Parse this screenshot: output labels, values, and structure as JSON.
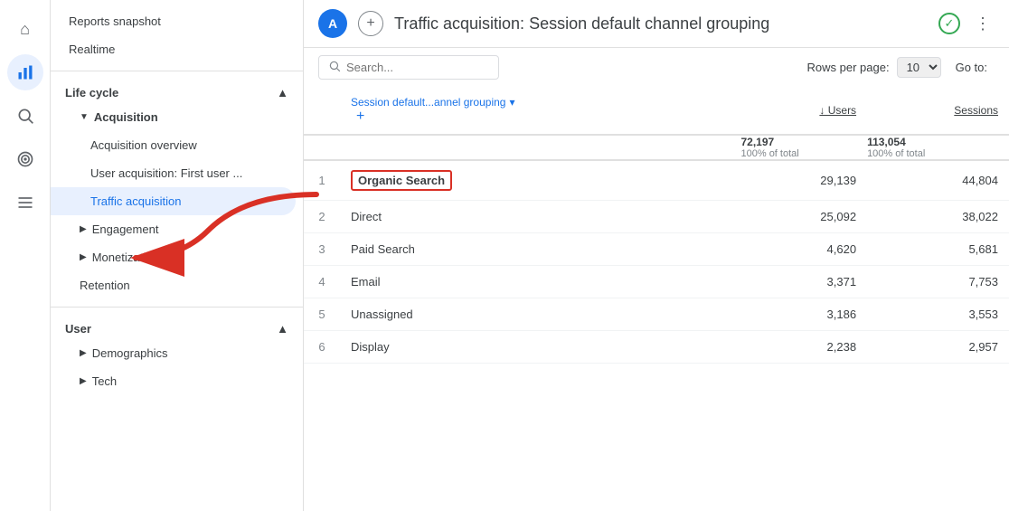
{
  "rail": {
    "icons": [
      {
        "name": "home-icon",
        "symbol": "⌂",
        "active": false
      },
      {
        "name": "chart-icon",
        "symbol": "📊",
        "active": true
      },
      {
        "name": "search-icon",
        "symbol": "🔍",
        "active": false
      },
      {
        "name": "target-icon",
        "symbol": "◎",
        "active": false
      },
      {
        "name": "list-icon",
        "symbol": "☰",
        "active": false
      }
    ]
  },
  "sidebar": {
    "snapshot_label": "Reports snapshot",
    "realtime_label": "Realtime",
    "lifecycle_label": "Life cycle",
    "sections": [
      {
        "label": "Acquisition",
        "expanded": true,
        "items": [
          {
            "label": "Acquisition overview",
            "level": 2,
            "active": false
          },
          {
            "label": "User acquisition: First user ...",
            "level": 2,
            "active": false
          },
          {
            "label": "Traffic acquisition",
            "level": 2,
            "active": true
          }
        ]
      },
      {
        "label": "Engagement",
        "expanded": false,
        "items": []
      },
      {
        "label": "Monetization",
        "expanded": false,
        "items": []
      },
      {
        "label": "Retention",
        "expanded": false,
        "items": [],
        "no_chevron": true
      }
    ],
    "user_label": "User",
    "user_sections": [
      {
        "label": "Demographics",
        "expanded": false
      },
      {
        "label": "Tech",
        "expanded": false
      }
    ]
  },
  "header": {
    "avatar_letter": "A",
    "title": "Traffic acquisition: Session default channel grouping",
    "add_button": "+",
    "check_symbol": "✓",
    "more_symbol": "⋮"
  },
  "toolbar": {
    "search_placeholder": "Search...",
    "rows_label": "Rows per page:",
    "rows_value": "10",
    "goto_label": "Go to:"
  },
  "table": {
    "col1_label": "Session default...annel grouping",
    "col2_label": "↓ Users",
    "col3_label": "Sessions",
    "total": {
      "users": "72,197",
      "users_sub": "100% of total",
      "sessions": "113,054",
      "sessions_sub": "100% of total"
    },
    "rows": [
      {
        "rank": "1",
        "channel": "Organic Search",
        "users": "29,139",
        "sessions": "44,804",
        "highlight": true
      },
      {
        "rank": "2",
        "channel": "Direct",
        "users": "25,092",
        "sessions": "38,022",
        "highlight": false
      },
      {
        "rank": "3",
        "channel": "Paid Search",
        "users": "4,620",
        "sessions": "5,681",
        "highlight": false
      },
      {
        "rank": "4",
        "channel": "Email",
        "users": "3,371",
        "sessions": "7,753",
        "highlight": false
      },
      {
        "rank": "5",
        "channel": "Unassigned",
        "users": "3,186",
        "sessions": "3,553",
        "highlight": false
      },
      {
        "rank": "6",
        "channel": "Display",
        "users": "2,238",
        "sessions": "2,957",
        "highlight": false
      }
    ]
  }
}
